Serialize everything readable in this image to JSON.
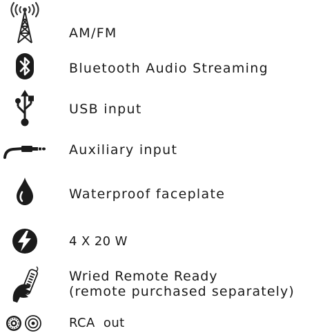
{
  "features": [
    {
      "icon": "radio-tower-icon",
      "label": "AM/FM"
    },
    {
      "icon": "bluetooth-icon",
      "label": "Bluetooth Audio Streaming"
    },
    {
      "icon": "usb-icon",
      "label": "USB input"
    },
    {
      "icon": "aux-cable-icon",
      "label": "Auxiliary input"
    },
    {
      "icon": "water-drop-icon",
      "label": "Waterproof faceplate"
    },
    {
      "icon": "power-bolt-icon",
      "label": "4 X 20 W"
    },
    {
      "icon": "wired-remote-icon",
      "label": "Wried Remote Ready",
      "label2": "(remote purchased separately)"
    },
    {
      "icon": "rca-connector-icon",
      "label": "RCA  out"
    }
  ]
}
